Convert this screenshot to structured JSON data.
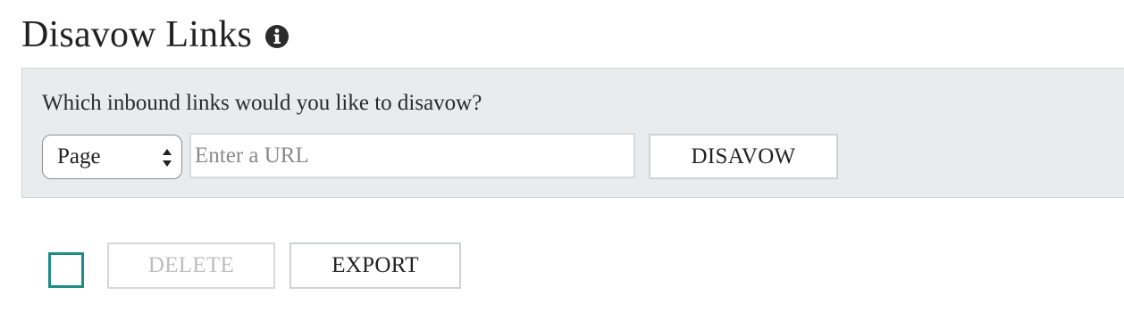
{
  "header": {
    "title": "Disavow Links"
  },
  "icons": {
    "info": "info-icon"
  },
  "form": {
    "question": "Which inbound links would you like to disavow?",
    "scope_select": {
      "selected": "Page"
    },
    "url_input": {
      "value": "",
      "placeholder": "Enter a URL"
    },
    "disavow_label": "DISAVOW"
  },
  "actions": {
    "select_all_checked": false,
    "delete_label": "DELETE",
    "delete_disabled": true,
    "export_label": "EXPORT"
  },
  "colors": {
    "accent": "#1e8d86",
    "panel_bg": "#eaebec",
    "disabled_text": "#bdbdbd"
  }
}
